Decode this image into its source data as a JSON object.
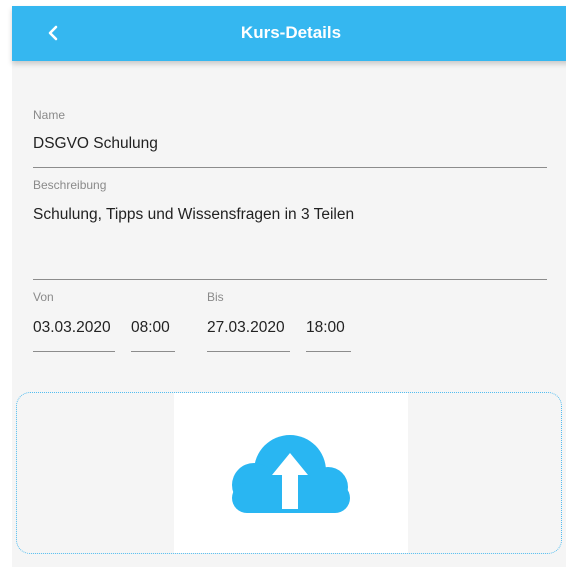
{
  "header": {
    "title": "Kurs-Details",
    "back_icon": "chevron-left-icon",
    "color": "#35b7f0"
  },
  "form": {
    "name": {
      "label": "Name",
      "value": "DSGVO Schulung"
    },
    "description": {
      "label": "Beschreibung",
      "value": "Schulung, Tipps und Wissensfragen in 3 Teilen"
    },
    "from": {
      "label": "Von",
      "date": "03.03.2020",
      "time": "08:00"
    },
    "to": {
      "label": "Bis",
      "date": "27.03.2020",
      "time": "18:00"
    }
  },
  "upload": {
    "icon": "cloud-upload-icon",
    "color": "#29b6f2"
  }
}
